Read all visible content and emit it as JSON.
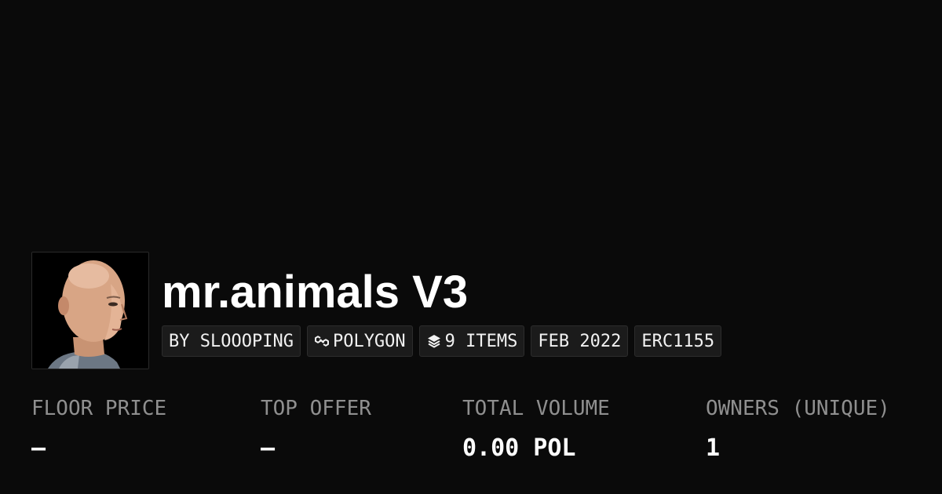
{
  "collection": {
    "title": "mr.animals V3"
  },
  "chips": [
    {
      "label": "BY SLOOOPING",
      "icon": ""
    },
    {
      "label": "POLYGON",
      "icon": "polygon-chain-icon"
    },
    {
      "label": "9 ITEMS",
      "icon": "layers-icon"
    },
    {
      "label": "FEB 2022",
      "icon": ""
    },
    {
      "label": "ERC1155",
      "icon": ""
    }
  ],
  "stats": [
    {
      "label": "FLOOR PRICE",
      "value": "–"
    },
    {
      "label": "TOP OFFER",
      "value": "–"
    },
    {
      "label": "TOTAL VOLUME",
      "value": "0.00 POL"
    },
    {
      "label": "OWNERS (UNIQUE)",
      "value": "1"
    }
  ],
  "colors": {
    "background": "#0a0a0a",
    "chip_background": "#1b1b1b",
    "label": "#8f8f8f",
    "text": "#ffffff"
  }
}
